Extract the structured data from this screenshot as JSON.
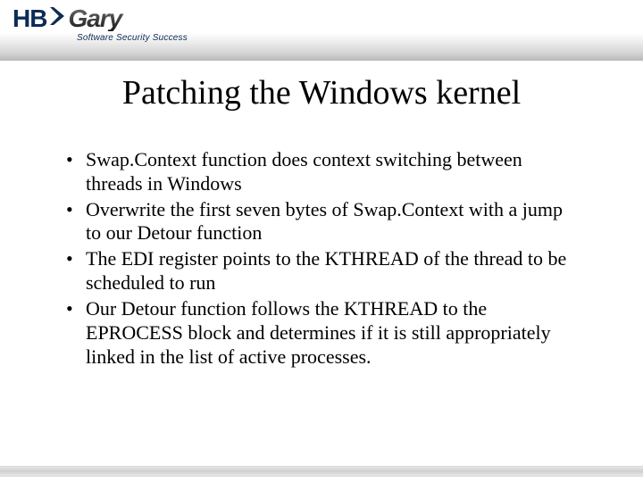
{
  "logo": {
    "hb": "HB",
    "gary": "Gary",
    "tagline": "Software Security Success"
  },
  "title": "Patching the Windows kernel",
  "bullets": [
    "Swap.Context function does context switching between threads in Windows",
    "Overwrite the first seven bytes of Swap.Context with a jump to our Detour function",
    "The EDI register points to the KTHREAD of the thread to be scheduled to run",
    "Our Detour function follows the KTHREAD to the EPROCESS block and determines if it is still appropriately linked in the list of active processes."
  ]
}
